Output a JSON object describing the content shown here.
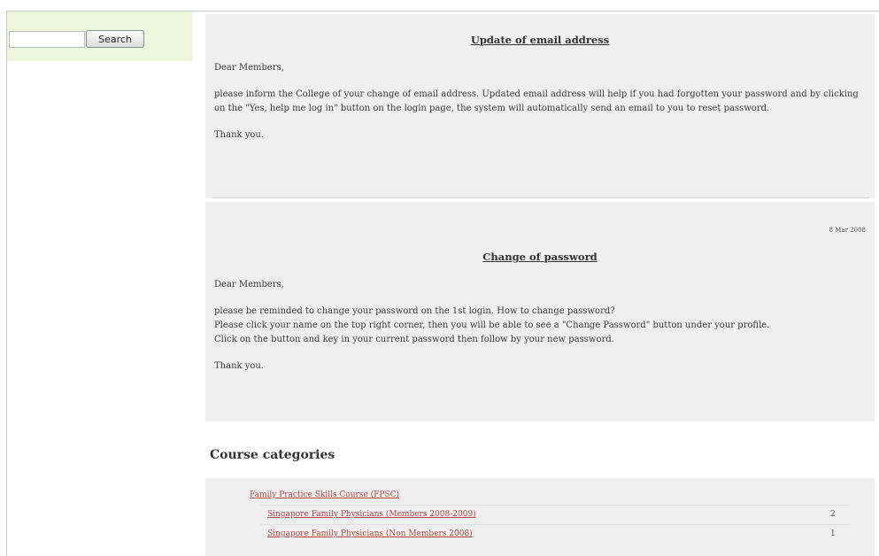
{
  "search": {
    "input_value": "",
    "button_label": "Search"
  },
  "news": [
    {
      "title": "Update of email address",
      "greeting": "Dear Members,",
      "body": "please inform the College of your change of email address. Updated email address will help if you had forgotten your password and by clicking on the \"Yes, help me log in\" button on the login page, the system will automatically send an email to you to reset password.",
      "closing": "Thank you."
    },
    {
      "date": "8 Mar 2008",
      "title": "Change of password",
      "greeting": "Dear Members,",
      "body_line1": "please be reminded to change your password on the 1st login. How to change password?",
      "body_line2": "Please click your name on the top right corner, then you will be able to see a \"Change Password\" button under your profile.",
      "body_line3": "Click on the button and key in your current password then follow by your new password.",
      "closing": "Thank you."
    }
  ],
  "courses": {
    "heading": "Course categories",
    "parent": "Family Practice Skills Course (FPSC)",
    "children": [
      {
        "name": "Singapore Family Physicians (Members 2008-2009)",
        "count": "2"
      },
      {
        "name": "Singapore Family Physicians (Non Members 2008)",
        "count": "1"
      }
    ]
  }
}
